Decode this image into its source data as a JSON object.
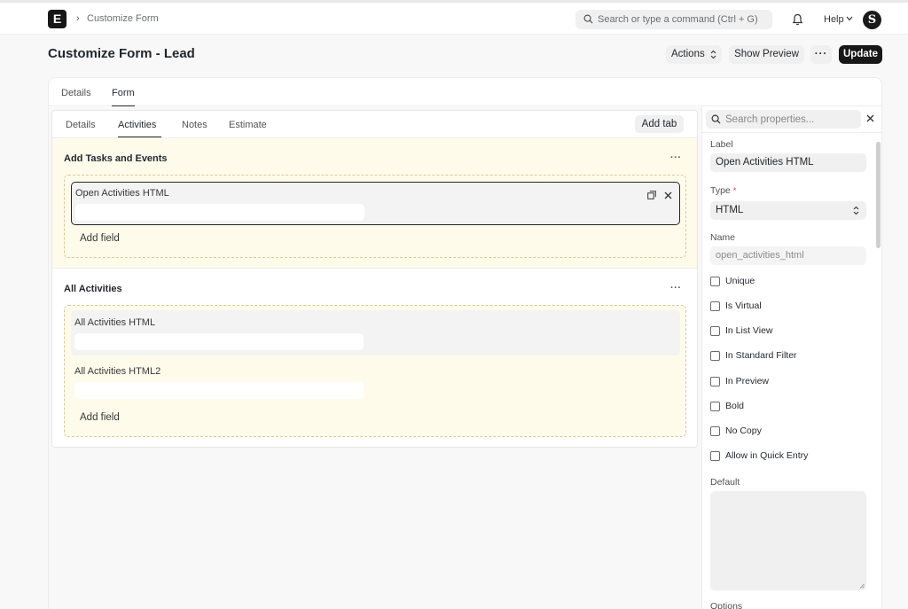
{
  "navbar": {
    "logo_letter": "E",
    "breadcrumb_sep": "›",
    "breadcrumb": "Customize Form",
    "search_placeholder": "Search or type a command (Ctrl + G)",
    "help_label": "Help",
    "avatar_letter": "S"
  },
  "page": {
    "title": "Customize Form - Lead",
    "actions_label": "Actions",
    "show_preview_label": "Show Preview",
    "more_label": "···",
    "update_label": "Update"
  },
  "top_tabs": [
    {
      "label": "Details",
      "active": false
    },
    {
      "label": "Form",
      "active": true
    }
  ],
  "form_editor": {
    "tabs": [
      {
        "label": "Details",
        "active": false
      },
      {
        "label": "Activities",
        "active": true
      },
      {
        "label": "Notes",
        "active": false
      },
      {
        "label": "Estimate",
        "active": false
      }
    ],
    "add_tab_label": "Add tab",
    "sections": [
      {
        "title": "Add Tasks and Events",
        "more": "···",
        "fields": [
          {
            "label": "Open Activities HTML",
            "selected": true
          }
        ],
        "add_field_label": "Add field"
      },
      {
        "title": "All Activities",
        "more": "···",
        "fields": [
          {
            "label": "All Activities HTML",
            "selected": false
          },
          {
            "label": "All Activities HTML2",
            "selected": false
          }
        ],
        "add_field_label": "Add field"
      }
    ]
  },
  "properties": {
    "search_placeholder": "Search properties...",
    "label_title": "Label",
    "label_value": "Open Activities HTML",
    "type_title": "Type",
    "required_mark": "*",
    "type_value": "HTML",
    "name_title": "Name",
    "name_value": "open_activities_html",
    "checkboxes": [
      {
        "label": "Unique",
        "checked": false
      },
      {
        "label": "Is Virtual",
        "checked": false
      },
      {
        "label": "In List View",
        "checked": false
      },
      {
        "label": "In Standard Filter",
        "checked": false
      },
      {
        "label": "In Preview",
        "checked": false
      },
      {
        "label": "Bold",
        "checked": false
      },
      {
        "label": "No Copy",
        "checked": false
      },
      {
        "label": "Allow in Quick Entry",
        "checked": false
      }
    ],
    "default_title": "Default",
    "options_title": "Options"
  },
  "colors": {
    "section_highlight": "#fffbeb",
    "primary_button": "#171717",
    "dashed_border": "#d6c99a"
  },
  "icons": [
    "search-icon",
    "bell-icon",
    "chevron-down-icon",
    "updown-icon",
    "expand-icon",
    "close-icon"
  ]
}
